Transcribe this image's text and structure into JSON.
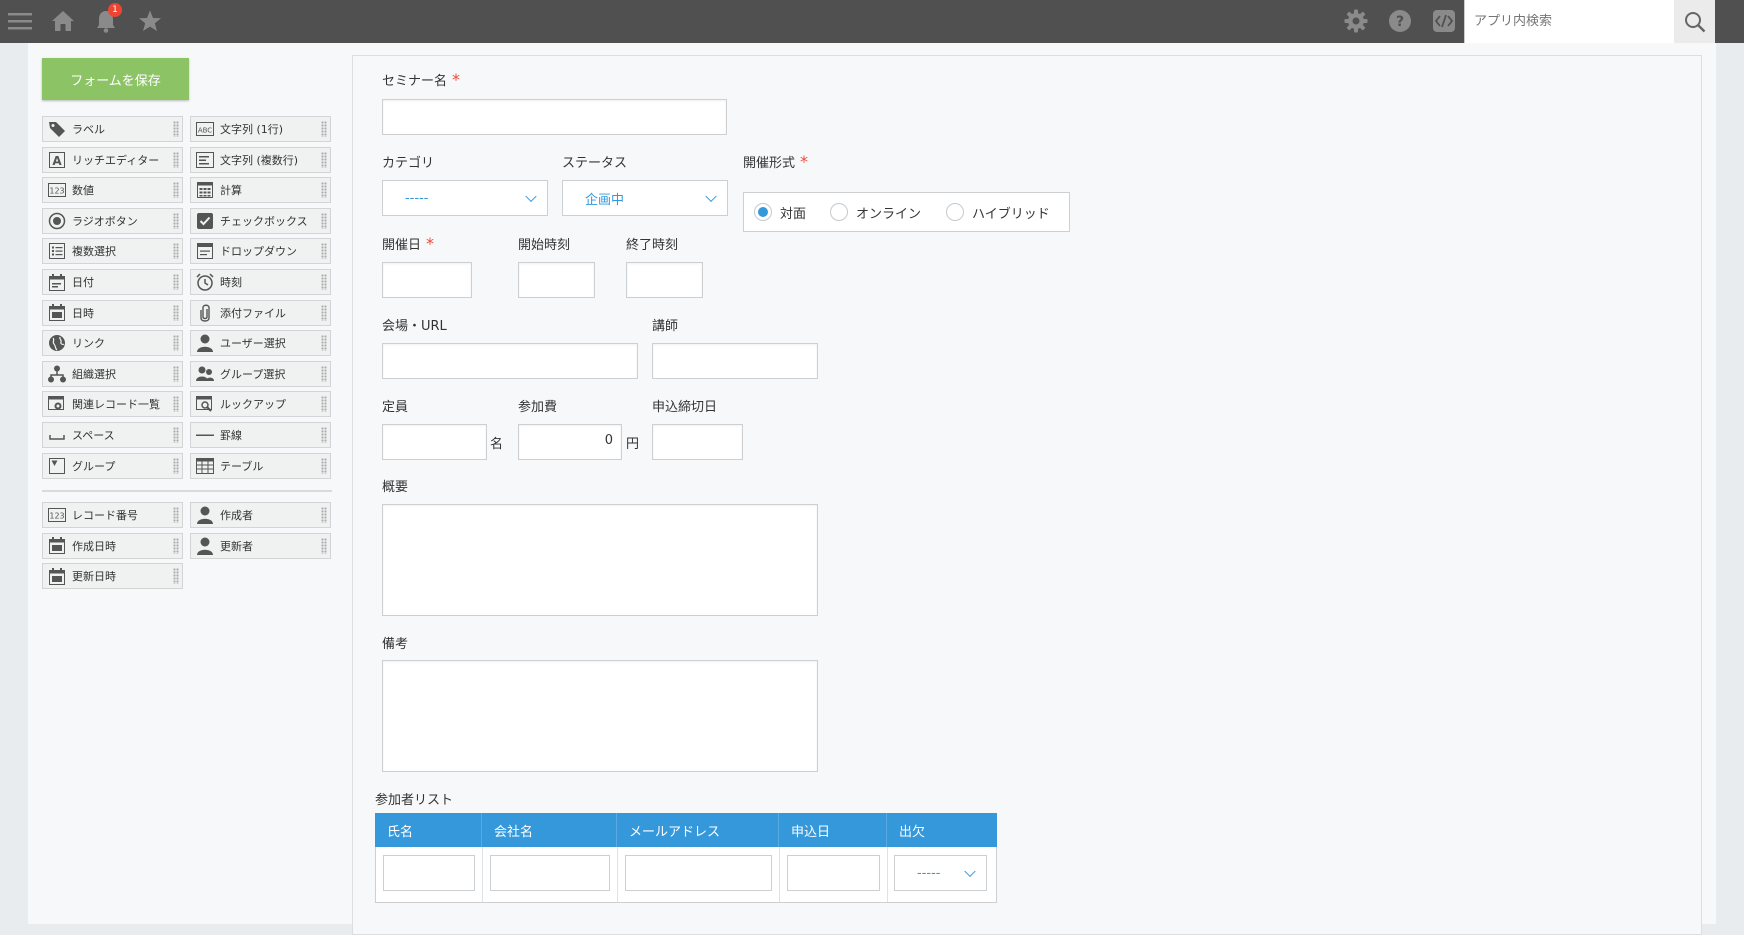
{
  "header": {
    "notification_count": "1",
    "search_placeholder": "アプリ内検索"
  },
  "palette": {
    "save_label": "フォームを保存",
    "fields": [
      {
        "label": "ラベル",
        "icon": "tag-icon"
      },
      {
        "label": "文字列 (1行)",
        "icon": "abc-icon"
      },
      {
        "label": "リッチエディター",
        "icon": "rich-editor-icon"
      },
      {
        "label": "文字列 (複数行)",
        "icon": "multiline-text-icon"
      },
      {
        "label": "数値",
        "icon": "number-icon"
      },
      {
        "label": "計算",
        "icon": "calculator-icon"
      },
      {
        "label": "ラジオボタン",
        "icon": "radio-icon"
      },
      {
        "label": "チェックボックス",
        "icon": "checkbox-icon"
      },
      {
        "label": "複数選択",
        "icon": "multi-select-icon"
      },
      {
        "label": "ドロップダウン",
        "icon": "dropdown-icon"
      },
      {
        "label": "日付",
        "icon": "date-icon"
      },
      {
        "label": "時刻",
        "icon": "clock-icon"
      },
      {
        "label": "日時",
        "icon": "datetime-icon"
      },
      {
        "label": "添付ファイル",
        "icon": "paperclip-icon"
      },
      {
        "label": "リンク",
        "icon": "globe-icon"
      },
      {
        "label": "ユーザー選択",
        "icon": "user-icon"
      },
      {
        "label": "組織選択",
        "icon": "org-icon"
      },
      {
        "label": "グループ選択",
        "icon": "group-icon"
      },
      {
        "label": "関連レコード一覧",
        "icon": "related-records-icon"
      },
      {
        "label": "ルックアップ",
        "icon": "lookup-icon"
      },
      {
        "label": "スペース",
        "icon": "space-icon"
      },
      {
        "label": "罫線",
        "icon": "line-icon"
      },
      {
        "label": "グループ",
        "icon": "group-fold-icon"
      },
      {
        "label": "テーブル",
        "icon": "table-icon"
      }
    ],
    "system_fields": [
      {
        "label": "レコード番号",
        "icon": "number-icon"
      },
      {
        "label": "作成者",
        "icon": "user-icon"
      },
      {
        "label": "作成日時",
        "icon": "datetime-icon"
      },
      {
        "label": "更新者",
        "icon": "user-icon"
      },
      {
        "label": "更新日時",
        "icon": "datetime-icon"
      }
    ]
  },
  "form": {
    "seminar_name": "セミナー名",
    "category": "カテゴリ",
    "category_value": "-----",
    "status": "ステータス",
    "status_value": "企画中",
    "format": "開催形式",
    "format_options": [
      "対面",
      "オンライン",
      "ハイブリッド"
    ],
    "format_selected": "対面",
    "date": "開催日",
    "start_time": "開始時刻",
    "end_time": "終了時刻",
    "venue": "会場・URL",
    "lecturer": "講師",
    "capacity": "定員",
    "capacity_unit": "名",
    "fee": "参加費",
    "fee_value": "0",
    "fee_unit": "円",
    "deadline": "申込締切日",
    "summary": "概要",
    "notes": "備考",
    "required_mark": "*"
  },
  "table": {
    "title": "参加者リスト",
    "columns": [
      "氏名",
      "会社名",
      "メールアドレス",
      "申込日",
      "出欠"
    ],
    "attendance_value": "-----"
  },
  "colors": {
    "topbar": "#505050",
    "save_button": "#8cc465",
    "accent": "#3498db",
    "required": "#e74c3c"
  }
}
